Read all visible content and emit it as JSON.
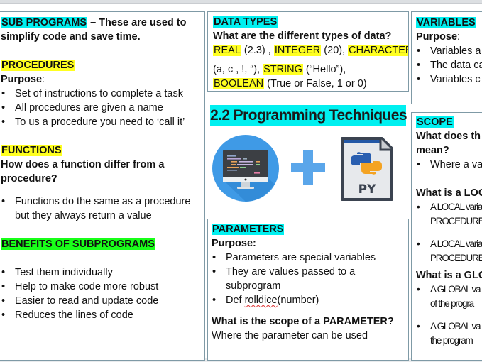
{
  "title": "2.2 Programming Techniques",
  "subprograms": {
    "heading": "SUB PROGRAMS",
    "intro": " – These are used to",
    "intro_line2": "simplify code and save time.",
    "procedures": {
      "heading": "PROCEDURES",
      "purpose_label": "Purpose",
      "purpose_colon": ":",
      "items": [
        "Set of instructions to complete a task",
        "All procedures are given a name",
        "To us a procedure you need to ‘call it’"
      ]
    },
    "functions": {
      "heading": "FUNCTIONS",
      "question_line1": "How does a function differ from a",
      "question_line2": "procedure?",
      "items_line1": "Functions do the same as a procedure",
      "items_line2": "but they always return a value"
    },
    "benefits": {
      "heading": "BENEFITS OF SUBPROGRAMS",
      "items": [
        "Test them individually",
        "Help to make code more robust",
        "Easier to read and update code",
        "Reduces the lines of code"
      ]
    }
  },
  "data_types": {
    "heading": "DATA TYPES",
    "question": "What are the different types of data?",
    "types": [
      {
        "name": "REAL",
        "example": " (2.3) , "
      },
      {
        "name": "INTEGER",
        "example": " (20), "
      },
      {
        "name": "CHARACTER",
        "example": ""
      },
      {
        "name": "STRING",
        "example": " (“Hello”),"
      },
      {
        "name": "BOOLEAN",
        "example": " (True or False, 1 or 0)"
      }
    ],
    "character_example": " (a, c , !, “), "
  },
  "variables": {
    "heading": "VARIABLES",
    "purpose_label": "Purpose",
    "purpose_colon": ":",
    "items": [
      "Variables a",
      "The data ca",
      "Variables c"
    ]
  },
  "scope": {
    "heading": "SCOPE",
    "question_line1": "What does th",
    "question_line2": "mean?",
    "item": "Where a va",
    "local_question": "What is a LOC",
    "local_items": [
      {
        "line1": "A LOCAL varia",
        "line2": "PROCEDURE"
      },
      {
        "line1": "A LOCAL varia",
        "line2": "PROCEDURE"
      }
    ],
    "global_question": "What is a GLO",
    "global_items": [
      {
        "line1": "A GLOBAL va",
        "line2": "of the progra"
      },
      {
        "line1": "A GLOBAL va",
        "line2": "the program"
      }
    ]
  },
  "parameters": {
    "heading": "PARAMETERS",
    "purpose_label": "Purpose:",
    "items": [
      {
        "line1": "Parameters are special variables",
        "line2": ""
      },
      {
        "line1": "They are values passed to a",
        "line2": "subprogram"
      }
    ],
    "code_prefix": "Def ",
    "code_name": "rolldice",
    "code_args": "(number)",
    "scope_question": "What is the scope of a PARAMETER?",
    "scope_answer": "Where the parameter can be used"
  },
  "icons": {
    "monitor": "monitor-code-icon",
    "plus": "plus-icon",
    "python_file": "python-file-icon",
    "python_file_label": "PY"
  },
  "colors": {
    "cyan_highlight": "#00f0f0",
    "yellow_highlight": "#ffff20",
    "green_highlight": "#19ff19",
    "border": "#7f9aa6"
  }
}
